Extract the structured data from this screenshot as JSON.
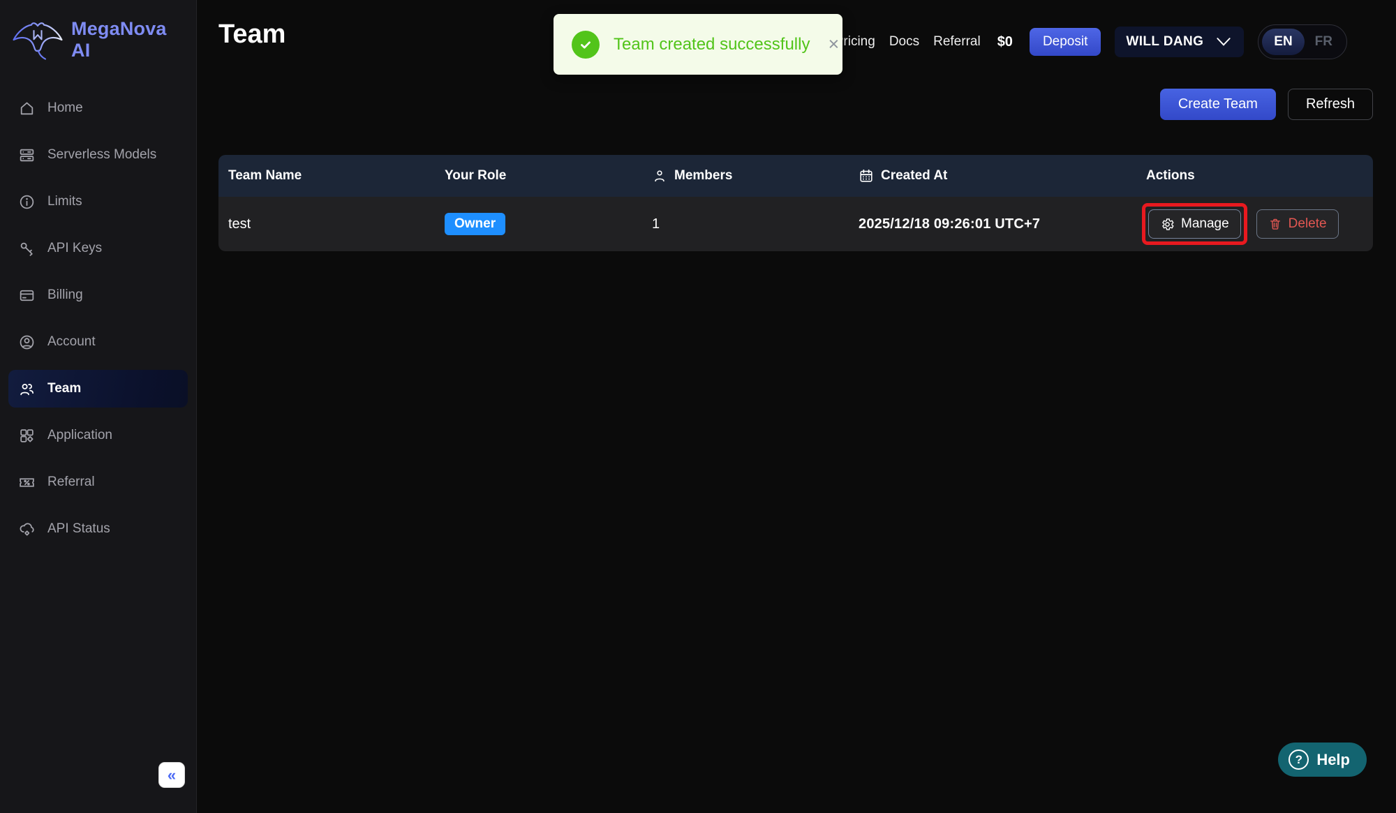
{
  "brand": {
    "name": "MegaNova AI"
  },
  "sidebar": {
    "items": [
      {
        "label": "Home"
      },
      {
        "label": "Serverless Models"
      },
      {
        "label": "Limits"
      },
      {
        "label": "API Keys"
      },
      {
        "label": "Billing"
      },
      {
        "label": "Account"
      },
      {
        "label": "Team",
        "active": true
      },
      {
        "label": "Application"
      },
      {
        "label": "Referral"
      },
      {
        "label": "API Status"
      }
    ],
    "collapse_glyph": "«"
  },
  "header": {
    "page_title": "Team",
    "toast": {
      "message": "Team created successfully",
      "close_glyph": "×"
    },
    "nav": {
      "pricing": "Pricing",
      "docs": "Docs",
      "referral": "Referral",
      "balance": "$0",
      "deposit": "Deposit",
      "user_name": "WILL DANG",
      "lang_en": "EN",
      "lang_fr": "FR"
    }
  },
  "toolbar": {
    "create_team": "Create Team",
    "refresh": "Refresh"
  },
  "table": {
    "columns": [
      "Team Name",
      "Your Role",
      "Members",
      "Created At",
      "Actions"
    ],
    "rows": [
      {
        "team_name": "test",
        "role": "Owner",
        "members": "1",
        "created_at": "2025/12/18 09:26:01 UTC+7",
        "manage_label": "Manage",
        "delete_label": "Delete"
      }
    ]
  },
  "help": {
    "label": "Help",
    "question_glyph": "?"
  },
  "colors": {
    "accent_blue": "#3b54d6",
    "badge_blue": "#1e8fff",
    "success_green": "#52c41a",
    "toast_bg": "#f4fbe9",
    "danger_red": "#e25752",
    "highlight_red": "#e8191f",
    "help_teal": "#136470",
    "header_navy": "#1c2637",
    "sidebar_bg": "#161619"
  }
}
